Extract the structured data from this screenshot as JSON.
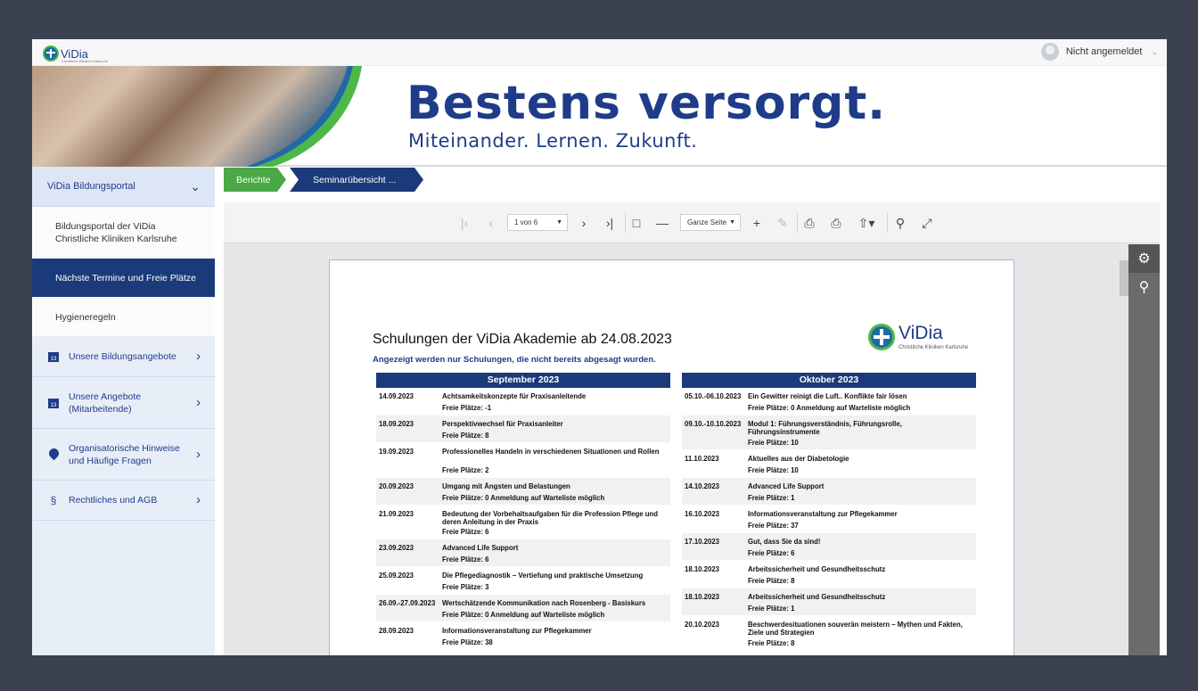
{
  "header": {
    "logo_name": "ViDia",
    "logo_tagline": "Christliche Kliniken Karlsruhe",
    "user_label": "Nicht angemeldet"
  },
  "banner": {
    "title": "Bestens versorgt.",
    "subtitle": "Miteinander. Lernen. Zukunft."
  },
  "sidebar": {
    "section": "ViDia Bildungsportal",
    "subitems": [
      {
        "label": "Bildungsportal der ViDia Christliche Kliniken Karlsruhe"
      },
      {
        "label": "Nächste Termine und Freie Plätze"
      },
      {
        "label": "Hygieneregeln"
      }
    ],
    "items": [
      {
        "label": "Unsere Bildungsangebote",
        "icon": "calendar-icon"
      },
      {
        "label": "Unsere Angebote (Mitarbeitende)",
        "icon": "calendar-icon"
      },
      {
        "label": "Organisatorische Hinweise und Häufige Fragen",
        "icon": "map-pin-icon"
      },
      {
        "label": "Rechtliches und AGB",
        "icon": "paragraph-icon"
      }
    ]
  },
  "breadcrumb": {
    "items": [
      "Berichte",
      "Seminarübersicht ..."
    ]
  },
  "toolbar": {
    "page_select": "1 von 6",
    "zoom_select": "Ganze Seite"
  },
  "document": {
    "title": "Schulungen der ViDia Akademie ab 24.08.2023",
    "subtitle": "Angezeigt werden nur Schulungen, die nicht bereits abgesagt wurden.",
    "logo_name": "ViDia",
    "logo_tagline": "Christliche Kliniken Karlsruhe",
    "september": {
      "heading": "September 2023",
      "rows": [
        {
          "date": "14.09.2023",
          "title": "Achtsamkeitskonzepte für Praxisanleitende",
          "places": "Freie Plätze: -1"
        },
        {
          "date": "18.09.2023",
          "title": "Perspektivwechsel für Praxisanleiter",
          "places": "Freie Plätze: 8"
        },
        {
          "date": "19.09.2023",
          "title": "Professionelles Handeln in verschiedenen Situationen und Rollen",
          "places": "Freie Plätze: 2"
        },
        {
          "date": "20.09.2023",
          "title": "Umgang mit Ängsten und Belastungen",
          "places": "Freie Plätze: 0 Anmeldung auf Warteliste möglich"
        },
        {
          "date": "21.09.2023",
          "title": "Bedeutung der Vorbehaltsaufgaben für die Profession Pflege und deren Anleitung in der Praxis",
          "places": "Freie Plätze: 6"
        },
        {
          "date": "23.09.2023",
          "title": "Advanced Life Support",
          "places": "Freie Plätze: 6"
        },
        {
          "date": "25.09.2023",
          "title": "Die Pflegediagnostik – Vertiefung und praktische Umsetzung",
          "places": "Freie Plätze: 3"
        },
        {
          "date": "26.09.-27.09.2023",
          "title": "Wertschätzende Kommunikation nach Rosenberg - Basiskurs",
          "places": "Freie Plätze: 0 Anmeldung auf Warteliste möglich"
        },
        {
          "date": "28.09.2023",
          "title": "Informationsveranstaltung zur Pflegekammer",
          "places": "Freie Plätze: 38"
        }
      ]
    },
    "oktober": {
      "heading": "Oktober 2023",
      "rows": [
        {
          "date": "05.10.-06.10.2023",
          "title": "Ein Gewitter reinigt die Luft.. Konflikte fair lösen",
          "places": "Freie Plätze: 0 Anmeldung auf Warteliste möglich"
        },
        {
          "date": "09.10.-10.10.2023",
          "title": "Modul 1: Führungsverständnis, Führungsrolle, Führungsinstrumente",
          "places": "Freie Plätze: 10"
        },
        {
          "date": "11.10.2023",
          "title": "Aktuelles aus der Diabetologie",
          "places": "Freie Plätze: 10"
        },
        {
          "date": "14.10.2023",
          "title": "Advanced Life Support",
          "places": "Freie Plätze: 1"
        },
        {
          "date": "16.10.2023",
          "title": "Informationsveranstaltung zur Pflegekammer",
          "places": "Freie Plätze: 37"
        },
        {
          "date": "17.10.2023",
          "title": "Gut, dass Sie da sind!",
          "places": "Freie Plätze: 6"
        },
        {
          "date": "18.10.2023",
          "title": "Arbeitssicherheit und Gesundheitsschutz",
          "places": "Freie Plätze: 8"
        },
        {
          "date": "18.10.2023",
          "title": "Arbeitssicherheit und Gesundheitsschutz",
          "places": "Freie Plätze: 1"
        },
        {
          "date": "20.10.2023",
          "title": "Beschwerdesituationen souverän meistern – Mythen und Fakten, Ziele und Strategien",
          "places": "Freie Plätze: 8"
        }
      ]
    }
  }
}
